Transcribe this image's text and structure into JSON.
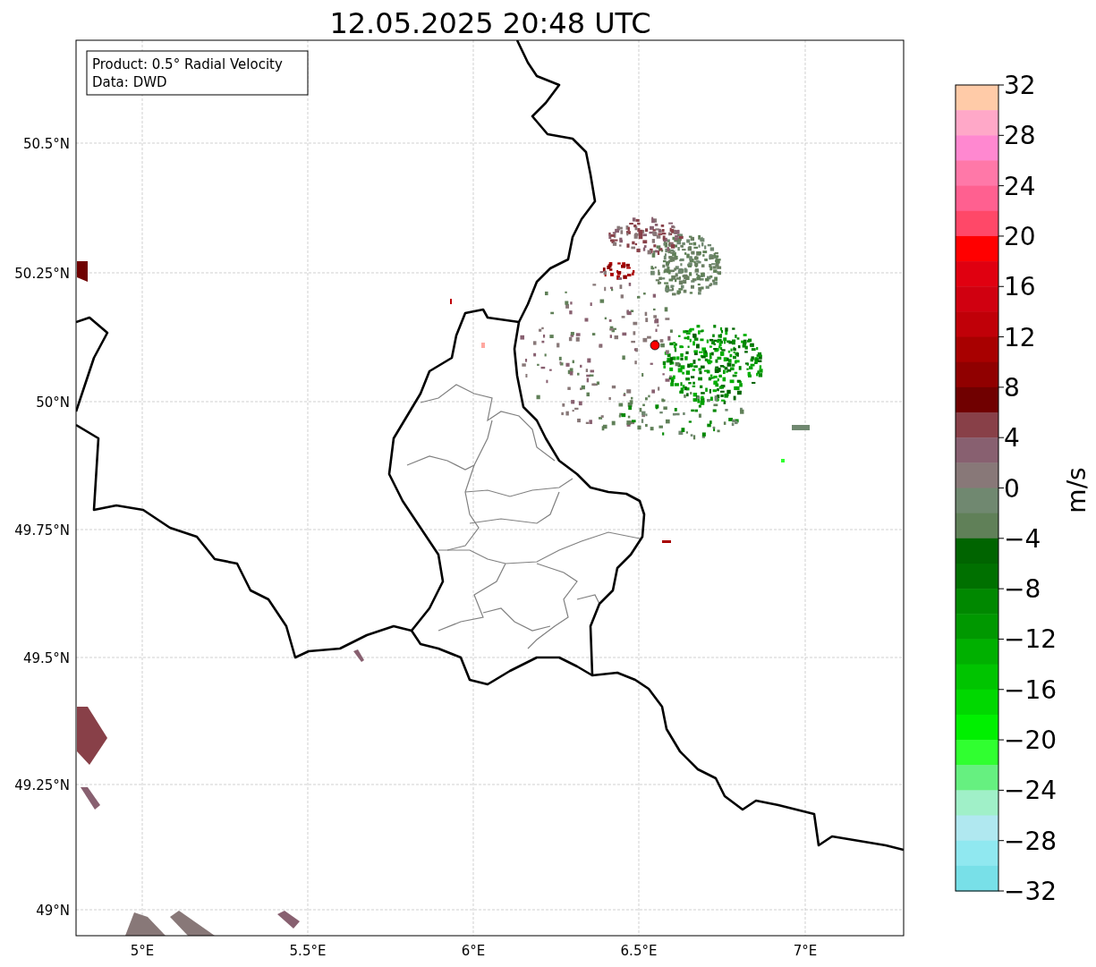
{
  "title": "12.05.2025 20:48 UTC",
  "info_box": [
    "Product: 0.5° Radial Velocity",
    "Data: DWD"
  ],
  "map": {
    "lat_ticks": [
      "50.5°N",
      "50.25°N",
      "50°N",
      "49.75°N",
      "49.5°N",
      "49.25°N",
      "49°N"
    ],
    "lon_ticks": [
      "5°E",
      "5.5°E",
      "6°E",
      "6.5°E",
      "7°E"
    ]
  },
  "colorbar": {
    "ticks": [
      "32",
      "28",
      "24",
      "20",
      "16",
      "12",
      "8",
      "4",
      "0",
      "−4",
      "−8",
      "−12",
      "−16",
      "−20",
      "−24",
      "−28",
      "−32"
    ],
    "label": "m/s"
  }
}
